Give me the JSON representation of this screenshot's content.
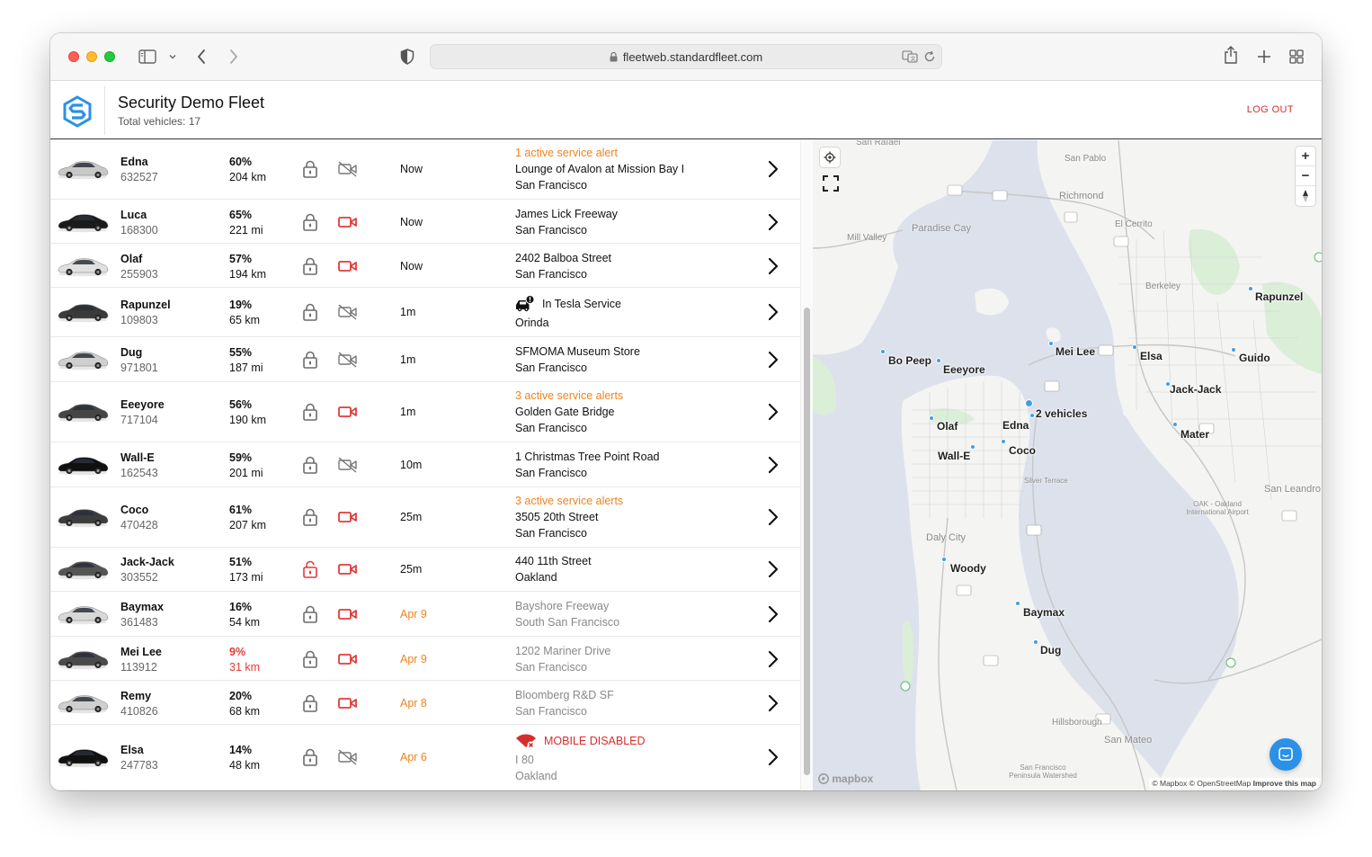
{
  "browser": {
    "url": "fleetweb.standardfleet.com"
  },
  "header": {
    "title": "Security Demo Fleet",
    "subtitle": "Total vehicles: 17",
    "logout": "LOG OUT"
  },
  "vehicles": [
    {
      "name": "Edna",
      "id": "632527",
      "battery": "60%",
      "range": "204 km",
      "lock": "locked",
      "camera": "off",
      "time": "Now",
      "alert": "1 active service alert",
      "line1": "Lounge of Avalon at Mission Bay I",
      "line2": "San Francisco"
    },
    {
      "name": "Luca",
      "id": "168300",
      "battery": "65%",
      "range": "221 mi",
      "lock": "locked",
      "camera": "on",
      "time": "Now",
      "alert": "",
      "line1": "James Lick Freeway",
      "line2": "San Francisco"
    },
    {
      "name": "Olaf",
      "id": "255903",
      "battery": "57%",
      "range": "194 km",
      "lock": "locked",
      "camera": "on",
      "time": "Now",
      "alert": "",
      "line1": "2402 Balboa Street",
      "line2": "San Francisco"
    },
    {
      "name": "Rapunzel",
      "id": "109803",
      "battery": "19%",
      "range": "65 km",
      "lock": "locked",
      "camera": "off",
      "time": "1m",
      "service": "In Tesla Service",
      "line1": "Orinda",
      "line2": ""
    },
    {
      "name": "Dug",
      "id": "971801",
      "battery": "55%",
      "range": "187 mi",
      "lock": "locked",
      "camera": "off",
      "time": "1m",
      "alert": "",
      "line1": "SFMOMA Museum Store",
      "line2": "San Francisco"
    },
    {
      "name": "Eeeyore",
      "id": "717104",
      "battery": "56%",
      "range": "190 km",
      "lock": "locked",
      "camera": "on",
      "time": "1m",
      "alert": "3 active service alerts",
      "line1": "Golden Gate Bridge",
      "line2": "San Francisco"
    },
    {
      "name": "Wall-E",
      "id": "162543",
      "battery": "59%",
      "range": "201 mi",
      "lock": "locked",
      "camera": "off",
      "time": "10m",
      "alert": "",
      "line1": "1 Christmas Tree Point Road",
      "line2": "San Francisco"
    },
    {
      "name": "Coco",
      "id": "470428",
      "battery": "61%",
      "range": "207 km",
      "lock": "locked",
      "camera": "on",
      "time": "25m",
      "alert": "3 active service alerts",
      "line1": "3505 20th Street",
      "line2": "San Francisco"
    },
    {
      "name": "Jack-Jack",
      "id": "303552",
      "battery": "51%",
      "range": "173 mi",
      "lock": "unlocked",
      "camera": "on",
      "time": "25m",
      "alert": "",
      "line1": "440 11th Street",
      "line2": "Oakland"
    },
    {
      "name": "Baymax",
      "id": "361483",
      "battery": "16%",
      "range": "54 km",
      "lock": "locked",
      "camera": "on",
      "time": "Apr 9",
      "alert": "",
      "line1": "Bayshore Freeway",
      "line2": "South San Francisco"
    },
    {
      "name": "Mei Lee",
      "id": "113912",
      "battery": "9%",
      "range": "31 km",
      "lock": "locked",
      "camera": "on",
      "time": "Apr 9",
      "alert": "",
      "line1": "1202 Mariner Drive",
      "line2": "San Francisco"
    },
    {
      "name": "Remy",
      "id": "410826",
      "battery": "20%",
      "range": "68 km",
      "lock": "locked",
      "camera": "on",
      "time": "Apr 8",
      "alert": "",
      "line1": "Bloomberg R&D SF",
      "line2": "San Francisco"
    },
    {
      "name": "Elsa",
      "id": "247783",
      "battery": "14%",
      "range": "48 km",
      "lock": "locked",
      "camera": "off",
      "time": "Apr 6",
      "mobile": "MOBILE DISABLED",
      "line1": "I 80",
      "line2": "Oakland"
    }
  ],
  "map": {
    "vehicle_labels": [
      "Rapunzel",
      "Bo Peep",
      "Eeeyore",
      "Mei Lee",
      "Elsa",
      "Guido",
      "Jack-Jack",
      "Edna",
      "2 vehicles",
      "Olaf",
      "Coco",
      "Wall-E",
      "Mater",
      "Woody",
      "Baymax",
      "Dug"
    ],
    "place_labels": [
      "San Rafael",
      "San Pablo",
      "Richmond",
      "El Cerrito",
      "Mill Valley",
      "Paradise Cay",
      "Berkeley",
      "Silver Terrace",
      "OAK - Oakland International Airport",
      "San Leandro",
      "Daly City",
      "Hillsborough",
      "San Mateo",
      "San Francisco Peninsula Watershed"
    ],
    "controls": {
      "zoom_in": "+",
      "zoom_out": "−"
    },
    "brand": "mapbox",
    "attribution_1": "© Mapbox © OpenStreetMap",
    "attribution_2": "Improve this map"
  },
  "colors": {
    "alert": "#f0821e",
    "danger": "#e23b3b",
    "link": "#3fa0e6",
    "water": "#dde1ec"
  }
}
